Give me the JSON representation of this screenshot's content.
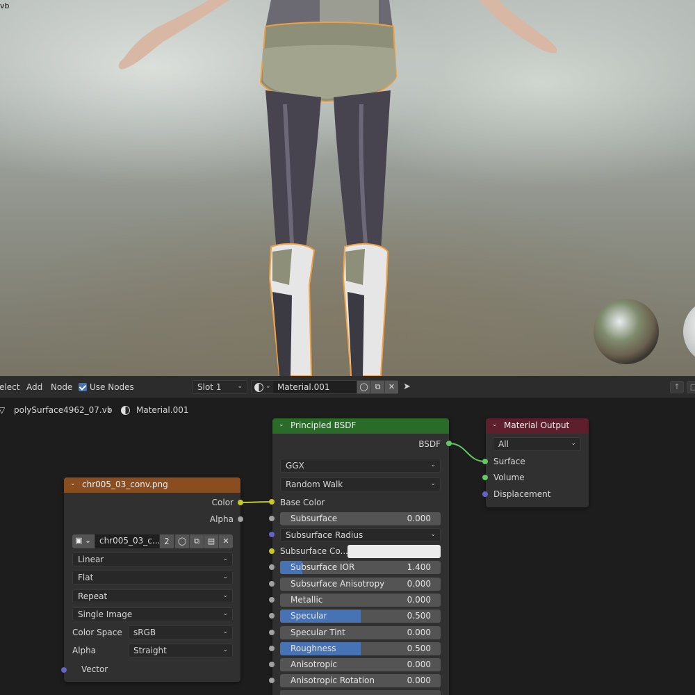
{
  "viewport": {
    "corner_text": "vb"
  },
  "header": {
    "menus": [
      "elect",
      "Add",
      "Node"
    ],
    "use_nodes_label": "Use Nodes",
    "use_nodes_checked": true,
    "slot": "Slot 1",
    "material_name": "Material.001"
  },
  "breadcrumb": {
    "object": "polySurface4962_07.vb",
    "material": "Material.001"
  },
  "image_node": {
    "title": "chr005_03_conv.png",
    "header_color": "#8a4d1f",
    "outputs": [
      "Color",
      "Alpha"
    ],
    "image_name": "chr005_03_c...",
    "users": "2",
    "interpolation": "Linear",
    "projection": "Flat",
    "extension": "Repeat",
    "source": "Single Image",
    "color_space_label": "Color Space",
    "color_space": "sRGB",
    "alpha_label": "Alpha",
    "alpha_mode": "Straight",
    "vector_label": "Vector"
  },
  "bsdf_node": {
    "title": "Principled BSDF",
    "header_color": "#2a6b2a",
    "output": "BSDF",
    "distribution": "GGX",
    "subsurface_method": "Random Walk",
    "base_color_label": "Base Color",
    "subsurface_radius_label": "Subsurface Radius",
    "subsurface_color_label": "Subsurface Co...",
    "sliders": [
      {
        "label": "Subsurface",
        "value": "0.000",
        "fill": 0
      },
      {
        "label": "Subsurface IOR",
        "value": "1.400",
        "fill": 0.14
      },
      {
        "label": "Subsurface Anisotropy",
        "value": "0.000",
        "fill": 0
      },
      {
        "label": "Metallic",
        "value": "0.000",
        "fill": 0
      },
      {
        "label": "Specular",
        "value": "0.500",
        "fill": 0.5
      },
      {
        "label": "Specular Tint",
        "value": "0.000",
        "fill": 0
      },
      {
        "label": "Roughness",
        "value": "0.500",
        "fill": 0.5
      },
      {
        "label": "Anisotropic",
        "value": "0.000",
        "fill": 0
      },
      {
        "label": "Anisotropic Rotation",
        "value": "0.000",
        "fill": 0
      }
    ]
  },
  "output_node": {
    "title": "Material Output",
    "header_color": "#5e1f2c",
    "target": "All",
    "inputs": [
      "Surface",
      "Volume",
      "Displacement"
    ]
  }
}
